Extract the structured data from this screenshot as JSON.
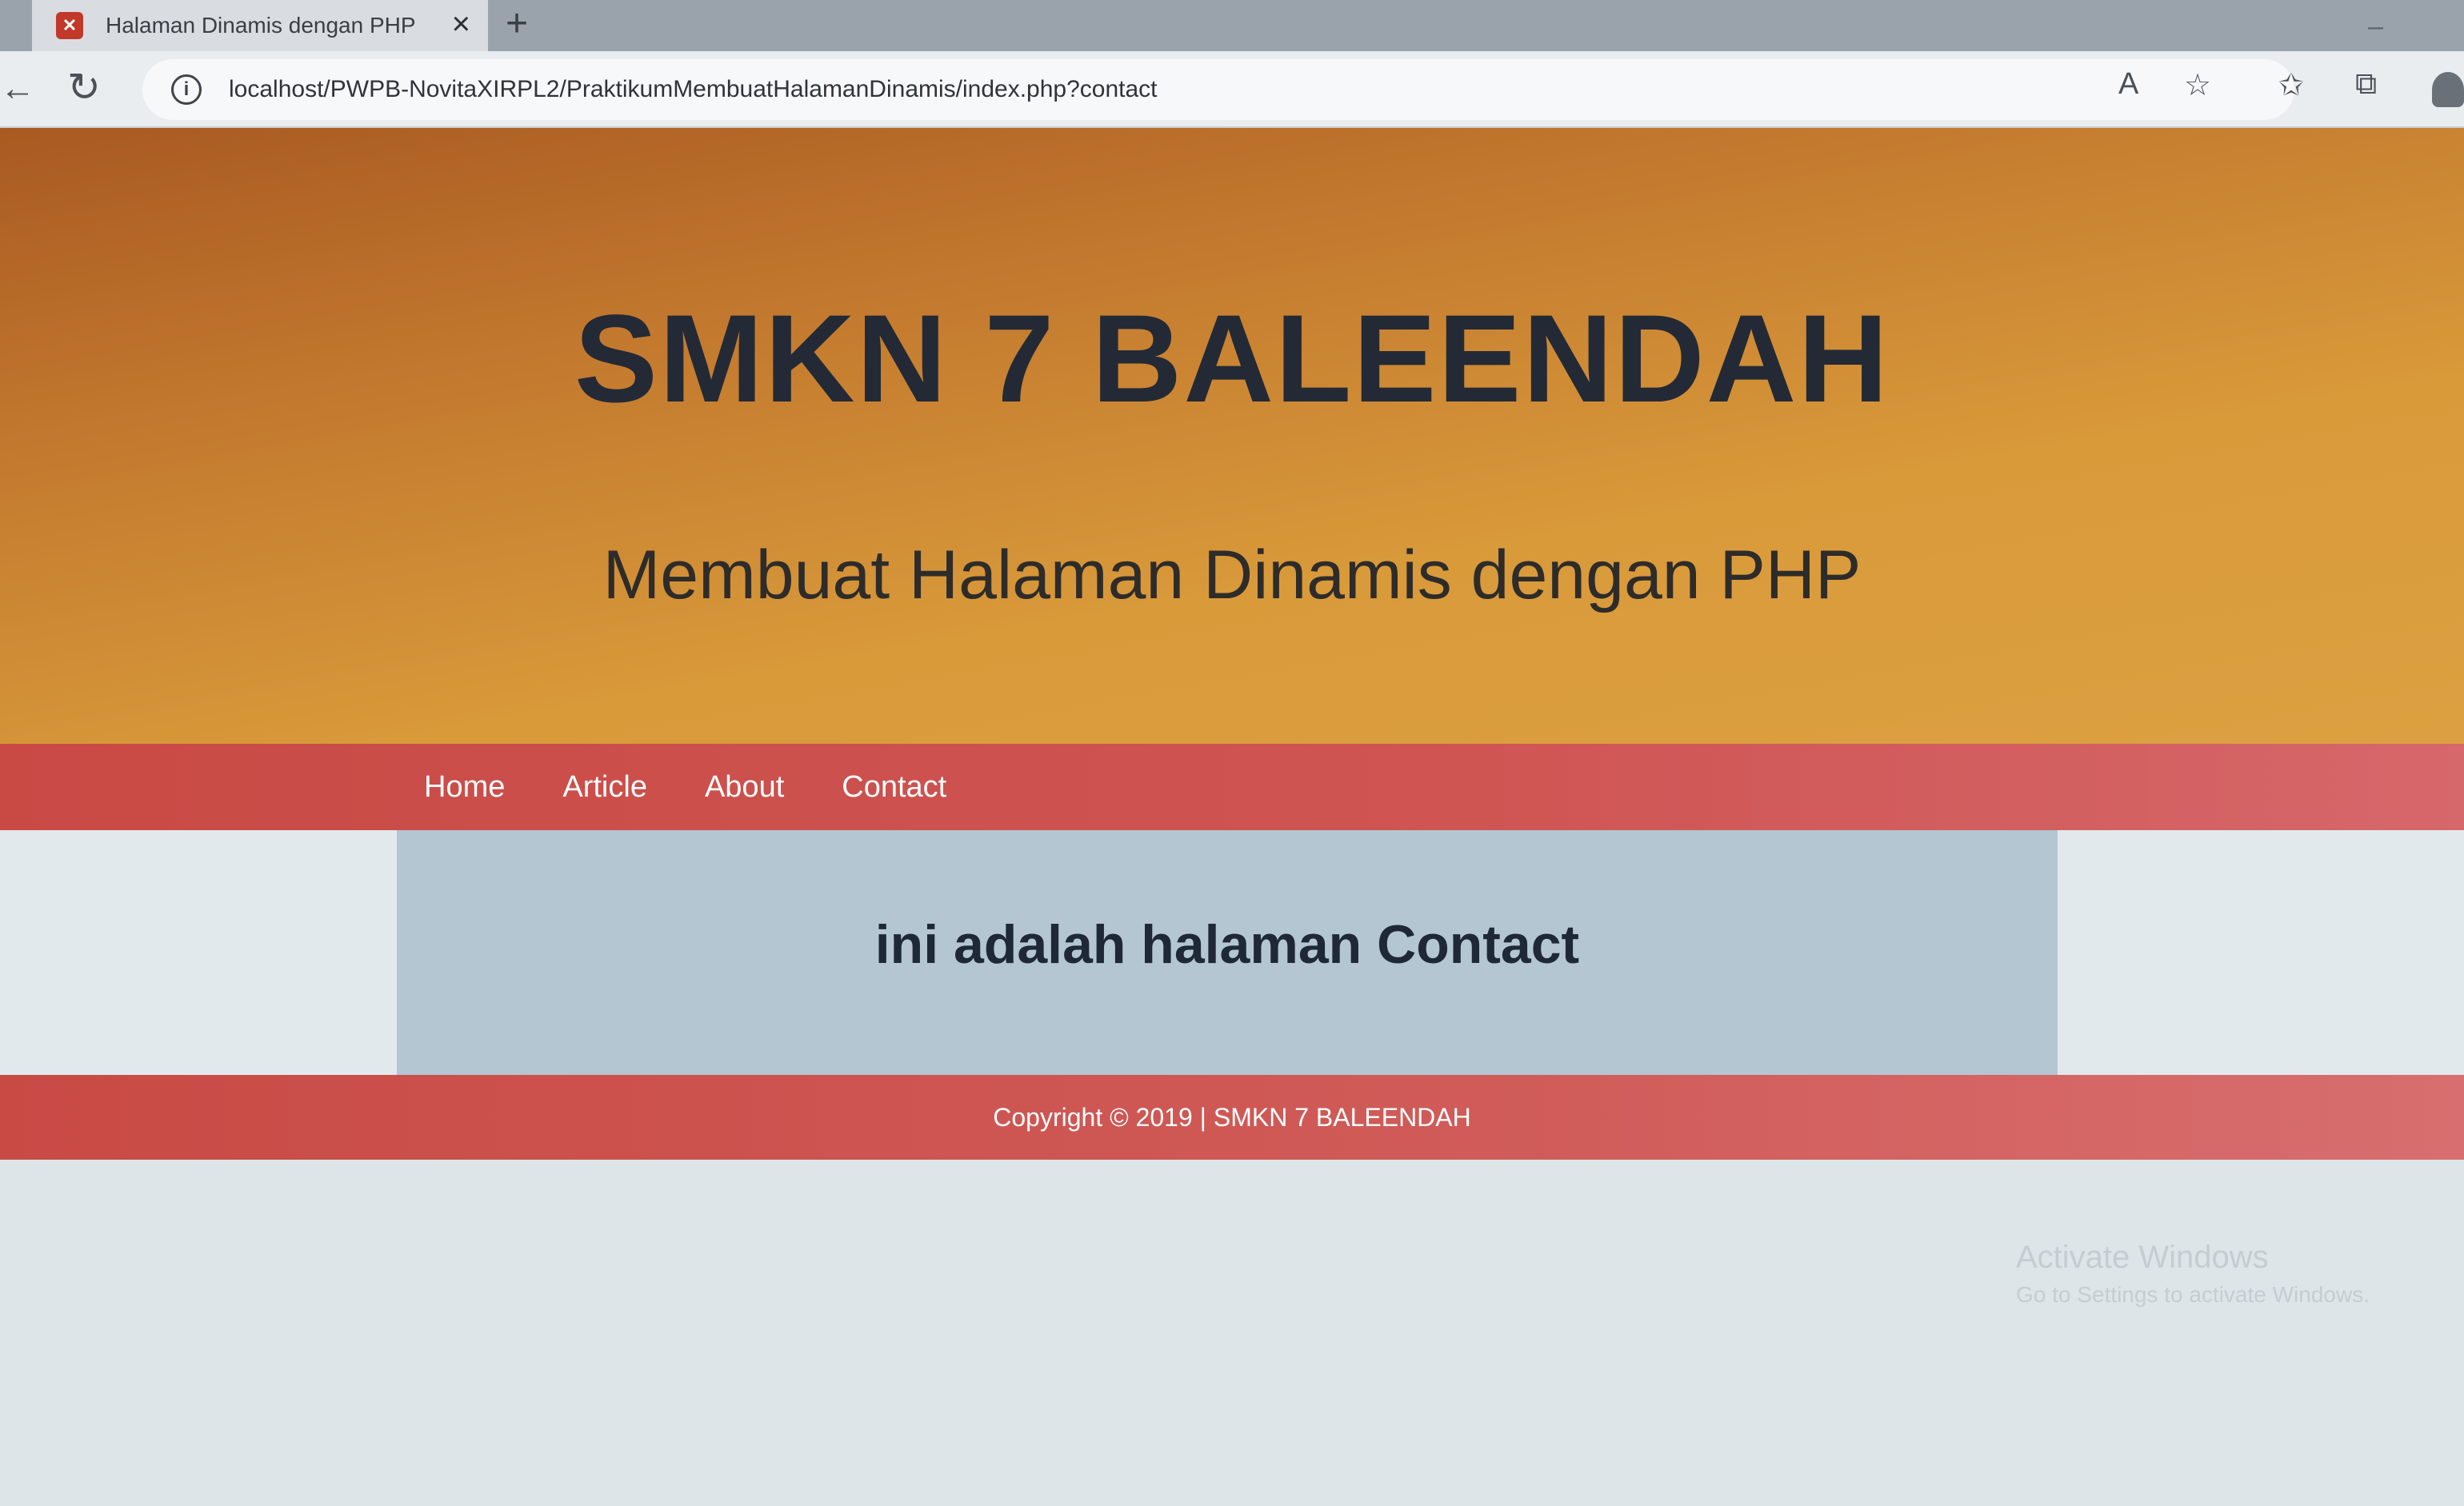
{
  "browser": {
    "tab_title": "Halaman Dinamis dengan PHP",
    "url": "localhost/PWPB-NovitaXIRPL2/PraktikumMembuatHalamanDinamis/index.php?contact"
  },
  "header": {
    "title": "SMKN 7 BALEENDAH",
    "subtitle": "Membuat Halaman Dinamis dengan PHP"
  },
  "nav": {
    "items": [
      {
        "label": "Home"
      },
      {
        "label": "Article"
      },
      {
        "label": "About"
      },
      {
        "label": "Contact"
      }
    ]
  },
  "content": {
    "text": "ini adalah halaman Contact"
  },
  "footer": {
    "text": "Copyright © 2019 | SMKN 7 BALEENDAH"
  },
  "watermark": {
    "title": "Activate Windows",
    "subtitle": "Go to Settings to activate Windows."
  },
  "colors": {
    "header_gradient_start": "#a85a22",
    "header_gradient_end": "#dca042",
    "nav_bg": "#c94a45",
    "content_box_bg": "#b4c6d2",
    "title_color": "#232a36"
  }
}
